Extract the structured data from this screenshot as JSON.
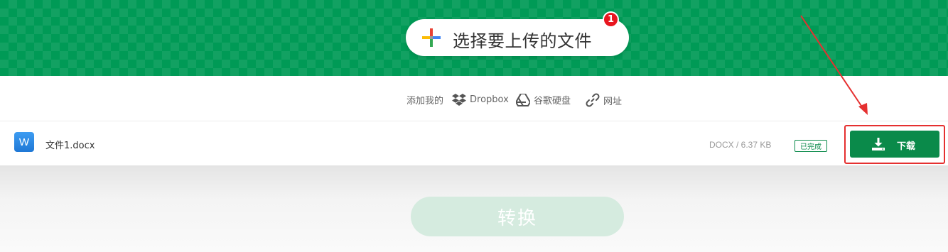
{
  "upload": {
    "label": "选择要上传的文件",
    "badge_count": "1"
  },
  "sources": {
    "add_from_label": "添加我的",
    "dropbox_label": "Dropbox",
    "google_drive_label": "谷歌硬盘",
    "url_label": "网址"
  },
  "file": {
    "icon_letter": "W",
    "name": "文件1.docx",
    "meta": "DOCX / 6.37 KB",
    "status": "已完成",
    "download_label": "下载"
  },
  "convert": {
    "label": "转换"
  },
  "colors": {
    "brand_green": "#009a56",
    "button_green": "#0a8a4a",
    "annotation_red": "#e53030",
    "badge_red": "#e8161f"
  }
}
